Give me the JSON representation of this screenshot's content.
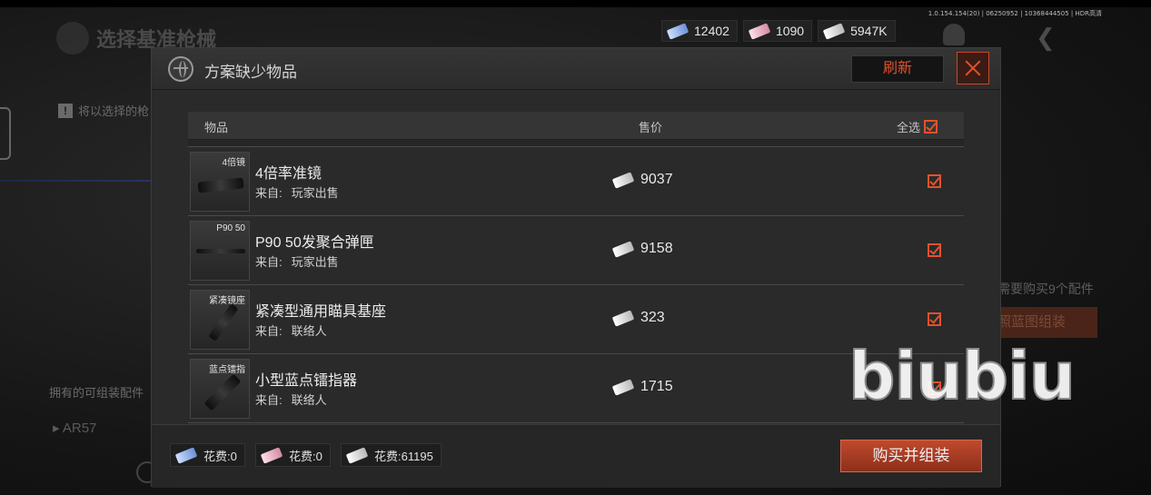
{
  "status": {
    "version": "1.0.154.154(20) | 06250952 | 10368444505 | HDR高清"
  },
  "background": {
    "title": "选择基准枪械",
    "warning_text": "将以选择的枪",
    "owned_label": "拥有的可组装配件",
    "weapon_item": "AR57",
    "need_text": "需要购买9个配件",
    "orange_button": "照蓝图组装"
  },
  "currency": [
    {
      "icon": "blue-ticket-icon",
      "value": "12402"
    },
    {
      "icon": "pink-ticket-icon",
      "value": "1090"
    },
    {
      "icon": "white-ticket-icon",
      "value": "5947K"
    }
  ],
  "modal": {
    "title": "方案缺少物品",
    "refresh_label": "刷新",
    "columns": {
      "item": "物品",
      "price": "售价",
      "select_all": "全选"
    },
    "select_all_checked": true,
    "items": [
      {
        "tag": "4倍镜",
        "name": "4倍率准镜",
        "source_label": "来自:",
        "source": "玩家出售",
        "price": "9037",
        "checked": true,
        "icon": "scope-icon"
      },
      {
        "tag": "P90 50",
        "name": "P90 50发聚合弹匣",
        "source_label": "来自:",
        "source": "玩家出售",
        "price": "9158",
        "checked": true,
        "icon": "magazine-icon"
      },
      {
        "tag": "紧凑镜座",
        "name": "紧凑型通用瞄具基座",
        "source_label": "来自:",
        "source": "联络人",
        "price": "323",
        "checked": true,
        "icon": "mount-icon"
      },
      {
        "tag": "蓝点镭指",
        "name": "小型蓝点镭指器",
        "source_label": "来自:",
        "source": "联络人",
        "price": "1715",
        "checked": true,
        "icon": "laser-icon"
      }
    ],
    "costs": [
      {
        "icon": "blue-ticket-icon",
        "label": "花费:0"
      },
      {
        "icon": "pink-ticket-icon",
        "label": "花费:0"
      },
      {
        "icon": "white-ticket-icon",
        "label": "花费:61195"
      }
    ],
    "buy_label": "购买并组装"
  },
  "watermark": "biubiu",
  "colors": {
    "accent": "#e0522e",
    "panel": "#2a2a2a",
    "button": "#b0432a"
  }
}
